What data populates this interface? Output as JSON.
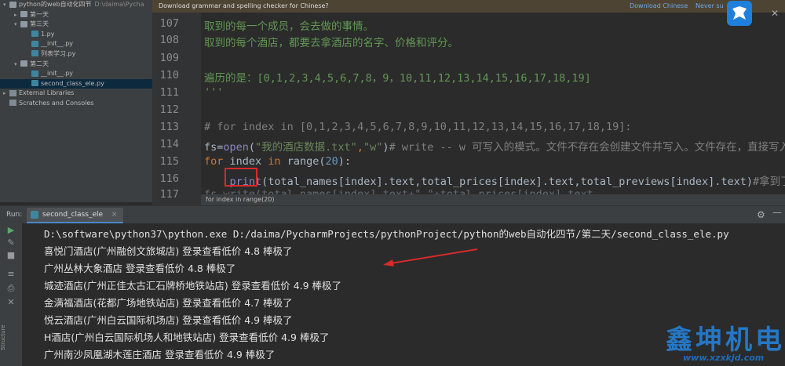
{
  "project_tree": {
    "items": [
      {
        "text": "python的web自动化四节",
        "path": "D:\\daima\\Pycha",
        "type": "folder",
        "depth": 0,
        "arrow": "▾"
      },
      {
        "text": "第一天",
        "type": "folder",
        "depth": 1,
        "arrow": "▸"
      },
      {
        "text": "第三天",
        "type": "folder",
        "depth": 1,
        "arrow": "▾"
      },
      {
        "text": "1.py",
        "type": "py",
        "depth": 2,
        "arrow": ""
      },
      {
        "text": "__init__.py",
        "type": "py",
        "depth": 2,
        "arrow": ""
      },
      {
        "text": "列表学习.py",
        "type": "py",
        "depth": 2,
        "arrow": ""
      },
      {
        "text": "第二天",
        "type": "folder",
        "depth": 1,
        "arrow": "▾"
      },
      {
        "text": "__init__.py",
        "type": "py",
        "depth": 2,
        "arrow": ""
      },
      {
        "text": "second_class_ele.py",
        "type": "py",
        "depth": 2,
        "arrow": "",
        "selected": true
      },
      {
        "text": "External Libraries",
        "type": "lib",
        "depth": 0,
        "arrow": "▸"
      },
      {
        "text": "Scratches and Consoles",
        "type": "lib",
        "depth": 0,
        "arrow": ""
      }
    ]
  },
  "notification": {
    "message": "Download grammar and spelling checker for Chinese?",
    "link_download": "Download Chinese",
    "link_never": "Never su"
  },
  "editor": {
    "line_numbers": [
      "107",
      "108",
      "109",
      "110",
      "111",
      "112",
      "113",
      "114",
      "115",
      "116",
      "117"
    ],
    "l107": "    取到的每一个成员，会去做的事情。",
    "l108": "    取到的每个酒店，都要去拿酒店的名字、价格和评分。",
    "l110": "遍历的是：[0,1,2,3,4,5,6,7,8，9，10,11,12,13,14,15,16,17,18,19]",
    "l111": "'''",
    "l113": "# for index in [0,1,2,3,4,5,6,7,8,9,10,11,12,13,14,15,16,17,18,19]:",
    "l114_a": "fs=",
    "l114_b": "open",
    "l114_c": "(",
    "l114_d": "\"我的酒店数据.txt\"",
    "l114_e": ",",
    "l114_f": "\"w\"",
    "l114_g": ")",
    "l114_h": "# write -- w  可写入的模式。文件不存在会创建文件并写入。文件存在，直接写入",
    "l115_a": "for",
    "l115_b": "  index ",
    "l115_c": "in",
    "l115_d": " range(",
    "l115_e": "20",
    "l115_f": "):",
    "l116_a": "    ",
    "l116_b": "print",
    "l116_c": "(total_names[index].text,total_prices[index].text,total_previews[index].text)",
    "l116_d": "#拿到了",
    "l117": "    fs.write(total_names[index].text+\"    \"+total_prices[index].text",
    "hint": "for index in range(20)"
  },
  "run_panel": {
    "run_label": "Run:",
    "tab_label": "second_class_ele",
    "tab_close": "×",
    "gear_icon": "⚙",
    "minimize_icon": "—"
  },
  "console": {
    "lines": [
      "D:\\software\\python37\\python.exe D:/daima/PycharmProjects/pythonProject/python的web自动化四节/第二天/second_class_ele.py",
      "喜悦门酒店(广州融创文旅城店) 登录查看低价 4.8 棒极了",
      "广州丛林大象酒店 登录查看低价 4.8 棒极了",
      "城迹酒店(广州正佳太古汇石牌桥地铁站店) 登录查看低价 4.9 棒极了",
      "金满福酒店(花都广场地铁站店) 登录查看低价 4.7 棒极了",
      "悦云酒店(广州白云国际机场店) 登录查看低价 4.9 棒极了",
      "H酒店(广州白云国际机场人和地铁站店) 登录查看低价 4.9 棒极了",
      "广州南沙凤凰湖木莲庄酒店 登录查看低价 4.9 棒极了"
    ]
  },
  "watermark": {
    "title": "鑫坤机电",
    "url": "www.xzxkjd.com"
  },
  "colors": {
    "annotation_red": "#d52b2b",
    "watermark_blue": "#2577c5"
  }
}
